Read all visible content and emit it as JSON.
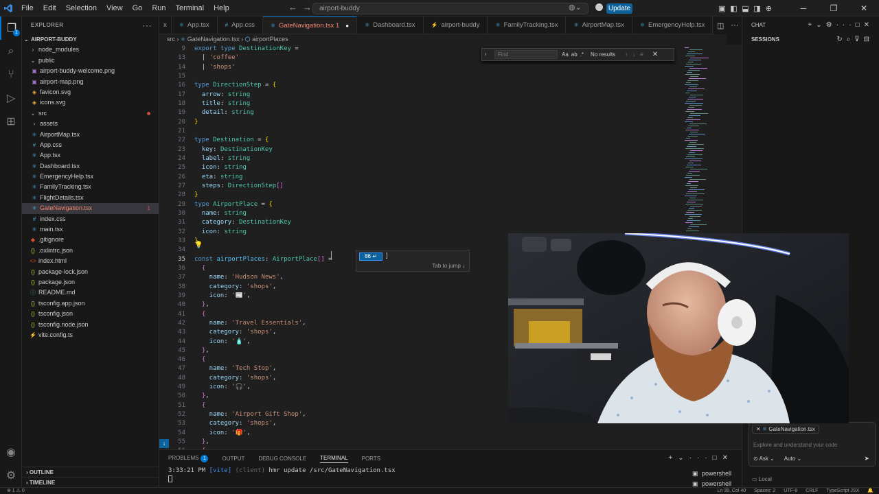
{
  "titlebar": {
    "menus": [
      "File",
      "Edit",
      "Selection",
      "View",
      "Go",
      "Run",
      "Terminal",
      "Help"
    ],
    "command_center": "airport-buddy",
    "update_label": "Update"
  },
  "activity": {
    "scm_badge": "1"
  },
  "explorer": {
    "header": "EXPLORER",
    "root": "AIRPORT-BUDDY",
    "items": [
      {
        "label": "node_modules",
        "kind": "folder-closed",
        "depth": 1
      },
      {
        "label": "public",
        "kind": "folder-open",
        "depth": 1
      },
      {
        "label": "airport-buddy-welcome.png",
        "kind": "image",
        "depth": 2
      },
      {
        "label": "airport-map.png",
        "kind": "image",
        "depth": 2
      },
      {
        "label": "favicon.svg",
        "kind": "svg",
        "depth": 2
      },
      {
        "label": "icons.svg",
        "kind": "svg",
        "depth": 2
      },
      {
        "label": "src",
        "kind": "folder-open",
        "depth": 1,
        "error": true
      },
      {
        "label": "assets",
        "kind": "folder-closed",
        "depth": 2
      },
      {
        "label": "AirportMap.tsx",
        "kind": "tsx",
        "depth": 2
      },
      {
        "label": "App.css",
        "kind": "css",
        "depth": 2
      },
      {
        "label": "App.tsx",
        "kind": "tsx",
        "depth": 2
      },
      {
        "label": "Dashboard.tsx",
        "kind": "tsx",
        "depth": 2
      },
      {
        "label": "EmergencyHelp.tsx",
        "kind": "tsx",
        "depth": 2
      },
      {
        "label": "FamilyTracking.tsx",
        "kind": "tsx",
        "depth": 2
      },
      {
        "label": "FlightDetails.tsx",
        "kind": "tsx",
        "depth": 2
      },
      {
        "label": "GateNavigation.tsx",
        "kind": "tsx",
        "depth": 2,
        "selected": true,
        "count": "1"
      },
      {
        "label": "index.css",
        "kind": "css",
        "depth": 2
      },
      {
        "label": "main.tsx",
        "kind": "tsx",
        "depth": 2
      },
      {
        "label": ".gitignore",
        "kind": "git",
        "depth": 1
      },
      {
        "label": ".oxlintrc.json",
        "kind": "json",
        "depth": 1
      },
      {
        "label": "index.html",
        "kind": "html",
        "depth": 1
      },
      {
        "label": "package-lock.json",
        "kind": "json",
        "depth": 1
      },
      {
        "label": "package.json",
        "kind": "json",
        "depth": 1
      },
      {
        "label": "README.md",
        "kind": "md",
        "depth": 1
      },
      {
        "label": "tsconfig.app.json",
        "kind": "json",
        "depth": 1
      },
      {
        "label": "tsconfig.json",
        "kind": "json",
        "depth": 1
      },
      {
        "label": "tsconfig.node.json",
        "kind": "json",
        "depth": 1
      },
      {
        "label": "vite.config.ts",
        "kind": "vite",
        "depth": 1
      }
    ],
    "outline": "OUTLINE",
    "timeline": "TIMELINE"
  },
  "tabs": [
    {
      "label": "x",
      "partial": true
    },
    {
      "label": "App.tsx",
      "icon": "tsx"
    },
    {
      "label": "App.css",
      "icon": "css"
    },
    {
      "label": "GateNavigation.tsx 1",
      "icon": "tsx",
      "active": true,
      "modified": true
    },
    {
      "label": "Dashboard.tsx",
      "icon": "tsx"
    },
    {
      "label": "airport-buddy",
      "icon": "vite"
    },
    {
      "label": "FamilyTracking.tsx",
      "icon": "tsx"
    },
    {
      "label": "AirportMap.tsx",
      "icon": "tsx"
    },
    {
      "label": "EmergencyHelp.tsx",
      "icon": "tsx"
    }
  ],
  "breadcrumb": [
    "src",
    "GateNavigation.tsx",
    "airportPlaces"
  ],
  "find": {
    "placeholder": "Find",
    "result": "No results"
  },
  "ghost": {
    "pill": "86 ↵",
    "hint": "Tab to jump ↓"
  },
  "code": {
    "line_numbers": [
      "9",
      "13",
      "14",
      "15",
      "16",
      "17",
      "18",
      "19",
      "20",
      "21",
      "22",
      "23",
      "24",
      "25",
      "26",
      "27",
      "28",
      "29",
      "30",
      "31",
      "32",
      "33",
      "34",
      "35",
      "36",
      "37",
      "38",
      "39",
      "40",
      "41",
      "42",
      "43",
      "44",
      "45",
      "46",
      "47",
      "48",
      "49",
      "50",
      "51",
      "52",
      "53",
      "54",
      "55",
      "56"
    ],
    "lines": [
      [
        [
          "k",
          "export "
        ],
        [
          "k",
          "type "
        ],
        [
          "t",
          "DestinationKey"
        ],
        [
          "w",
          " ="
        ]
      ],
      [
        [
          "w",
          "  | "
        ],
        [
          "s",
          "'coffee'"
        ]
      ],
      [
        [
          "w",
          "  | "
        ],
        [
          "s",
          "'shops'"
        ]
      ],
      [],
      [
        [
          "k",
          "type "
        ],
        [
          "t",
          "DirectionStep"
        ],
        [
          "w",
          " = "
        ],
        [
          "y",
          "{"
        ]
      ],
      [
        [
          "p",
          "  arrow"
        ],
        [
          "w",
          ": "
        ],
        [
          "t",
          "string"
        ]
      ],
      [
        [
          "p",
          "  title"
        ],
        [
          "w",
          ": "
        ],
        [
          "t",
          "string"
        ]
      ],
      [
        [
          "p",
          "  detail"
        ],
        [
          "w",
          ": "
        ],
        [
          "t",
          "string"
        ]
      ],
      [
        [
          "y",
          "}"
        ]
      ],
      [],
      [
        [
          "k",
          "type "
        ],
        [
          "t",
          "Destination"
        ],
        [
          "w",
          " = "
        ],
        [
          "y",
          "{"
        ]
      ],
      [
        [
          "p",
          "  key"
        ],
        [
          "w",
          ": "
        ],
        [
          "t",
          "DestinationKey"
        ]
      ],
      [
        [
          "p",
          "  label"
        ],
        [
          "w",
          ": "
        ],
        [
          "t",
          "string"
        ]
      ],
      [
        [
          "p",
          "  icon"
        ],
        [
          "w",
          ": "
        ],
        [
          "t",
          "string"
        ]
      ],
      [
        [
          "p",
          "  eta"
        ],
        [
          "w",
          ": "
        ],
        [
          "t",
          "string"
        ]
      ],
      [
        [
          "p",
          "  steps"
        ],
        [
          "w",
          ": "
        ],
        [
          "t",
          "DirectionStep"
        ],
        [
          "b",
          "[]"
        ]
      ],
      [
        [
          "y",
          "}"
        ]
      ],
      [
        [
          "k",
          "type "
        ],
        [
          "t",
          "AirportPlace"
        ],
        [
          "w",
          " = "
        ],
        [
          "y",
          "{"
        ]
      ],
      [
        [
          "p",
          "  name"
        ],
        [
          "w",
          ": "
        ],
        [
          "t",
          "string"
        ]
      ],
      [
        [
          "p",
          "  category"
        ],
        [
          "w",
          ": "
        ],
        [
          "t",
          "DestinationKey"
        ]
      ],
      [
        [
          "p",
          "  icon"
        ],
        [
          "w",
          ": "
        ],
        [
          "t",
          "string"
        ]
      ],
      [
        [
          "y",
          "}"
        ]
      ],
      [],
      [
        [
          "k",
          "const "
        ],
        [
          "v",
          "airportPlaces"
        ],
        [
          "w",
          ": "
        ],
        [
          "t",
          "AirportPlace"
        ],
        [
          "b",
          "[]"
        ],
        [
          "w",
          " = "
        ]
      ],
      [
        [
          "b",
          "  {"
        ]
      ],
      [
        [
          "p",
          "    name"
        ],
        [
          "w",
          ": "
        ],
        [
          "s",
          "'Hudson News'"
        ],
        [
          "w",
          ","
        ]
      ],
      [
        [
          "p",
          "    category"
        ],
        [
          "w",
          ": "
        ],
        [
          "s",
          "'shops'"
        ],
        [
          "w",
          ","
        ]
      ],
      [
        [
          "p",
          "    icon"
        ],
        [
          "w",
          ": "
        ],
        [
          "s",
          "'📰'"
        ],
        [
          "w",
          ","
        ]
      ],
      [
        [
          "b",
          "  }"
        ],
        [
          "w",
          ","
        ]
      ],
      [
        [
          "b",
          "  {"
        ]
      ],
      [
        [
          "p",
          "    name"
        ],
        [
          "w",
          ": "
        ],
        [
          "s",
          "'Travel Essentials'"
        ],
        [
          "w",
          ","
        ]
      ],
      [
        [
          "p",
          "    category"
        ],
        [
          "w",
          ": "
        ],
        [
          "s",
          "'shops'"
        ],
        [
          "w",
          ","
        ]
      ],
      [
        [
          "p",
          "    icon"
        ],
        [
          "w",
          ": "
        ],
        [
          "s",
          "'🧴'"
        ],
        [
          "w",
          ","
        ]
      ],
      [
        [
          "b",
          "  }"
        ],
        [
          "w",
          ","
        ]
      ],
      [
        [
          "b",
          "  {"
        ]
      ],
      [
        [
          "p",
          "    name"
        ],
        [
          "w",
          ": "
        ],
        [
          "s",
          "'Tech Stop'"
        ],
        [
          "w",
          ","
        ]
      ],
      [
        [
          "p",
          "    category"
        ],
        [
          "w",
          ": "
        ],
        [
          "s",
          "'shops'"
        ],
        [
          "w",
          ","
        ]
      ],
      [
        [
          "p",
          "    icon"
        ],
        [
          "w",
          ": "
        ],
        [
          "s",
          "'🎧'"
        ],
        [
          "w",
          ","
        ]
      ],
      [
        [
          "b",
          "  }"
        ],
        [
          "w",
          ","
        ]
      ],
      [
        [
          "b",
          "  {"
        ]
      ],
      [
        [
          "p",
          "    name"
        ],
        [
          "w",
          ": "
        ],
        [
          "s",
          "'Airport Gift Shop'"
        ],
        [
          "w",
          ","
        ]
      ],
      [
        [
          "p",
          "    category"
        ],
        [
          "w",
          ": "
        ],
        [
          "s",
          "'shops'"
        ],
        [
          "w",
          ","
        ]
      ],
      [
        [
          "p",
          "    icon"
        ],
        [
          "w",
          ": "
        ],
        [
          "s",
          "'🎁'"
        ],
        [
          "w",
          ","
        ]
      ],
      [
        [
          "b",
          "  }"
        ],
        [
          "w",
          ","
        ]
      ],
      [
        [
          "b",
          "  {"
        ]
      ]
    ]
  },
  "panel": {
    "tabs": [
      "PROBLEMS",
      "OUTPUT",
      "DEBUG CONSOLE",
      "TERMINAL",
      "PORTS"
    ],
    "problems_count": "1",
    "terminal_time": "3:33:21 PM",
    "terminal_tag": "[vite]",
    "terminal_client": "(client)",
    "terminal_msg": "hmr update /src/GateNavigation.tsx",
    "shells": [
      "powershell",
      "powershell"
    ]
  },
  "chat": {
    "title": "CHAT",
    "sessions": "SESSIONS",
    "context_file": "GateNavigation.tsx",
    "placeholder": "Explore and understand your code",
    "mode": "Ask",
    "model": "Auto",
    "location": "Local"
  },
  "status": {
    "left": "⊗ 1 ⚠ 0",
    "position": "Ln 35, Col 40",
    "spaces": "Spaces: 2",
    "encoding": "UTF-8",
    "eol": "CRLF",
    "language": "TypeScript JSX"
  },
  "colors": {
    "accent": "#0078d4",
    "error": "#f14c4c"
  }
}
